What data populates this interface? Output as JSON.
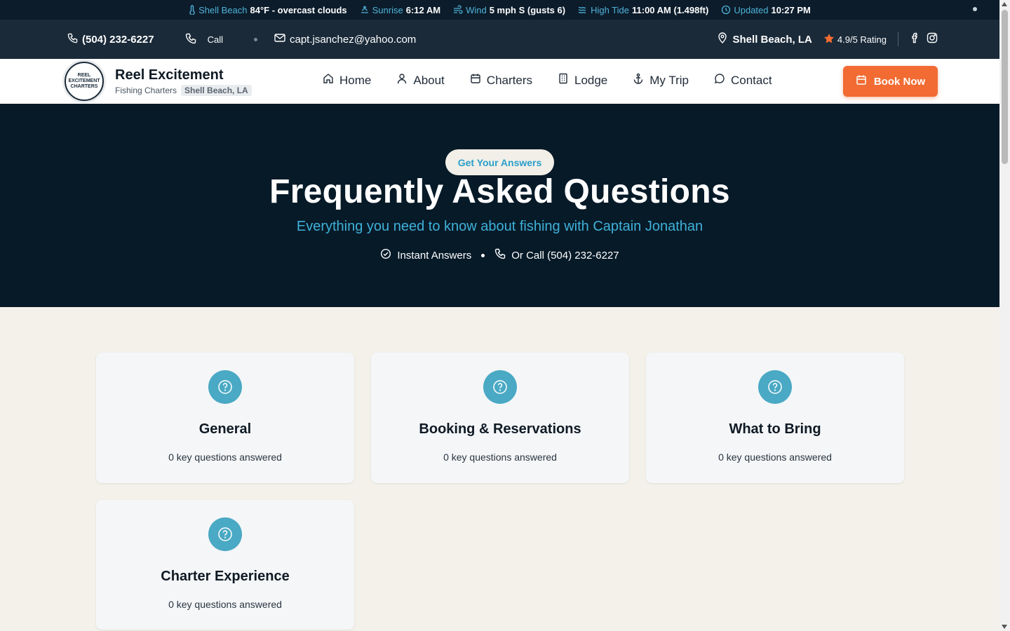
{
  "weather": {
    "location_label": "Shell Beach",
    "location_value": "84°F - overcast clouds",
    "sunrise_label": "Sunrise",
    "sunrise_value": "6:12 AM",
    "wind_label": "Wind",
    "wind_value": "5 mph S (gusts 6)",
    "tide_label": "High Tide",
    "tide_value": "11:00 AM (1.498ft)",
    "updated_label": "Updated",
    "updated_value": "10:27 PM"
  },
  "contact": {
    "phone": "(504) 232-6227",
    "call_label": "Call",
    "email": "capt.jsanchez@yahoo.com",
    "location": "Shell Beach, LA",
    "rating": "4.9/5 Rating"
  },
  "brand": {
    "name": "Reel Excitement",
    "subtitle": "Fishing Charters",
    "tag": "Shell Beach, LA",
    "logo_lines": [
      "REEL",
      "EXCITEMENT",
      "CHARTERS"
    ]
  },
  "nav": {
    "items": [
      {
        "label": "Home",
        "icon": "home-icon"
      },
      {
        "label": "About",
        "icon": "user-icon"
      },
      {
        "label": "Charters",
        "icon": "calendar-icon"
      },
      {
        "label": "Lodge",
        "icon": "building-icon"
      },
      {
        "label": "My Trip",
        "icon": "anchor-icon"
      },
      {
        "label": "Contact",
        "icon": "chat-icon"
      }
    ],
    "book_label": "Book Now"
  },
  "hero": {
    "pill": "Get Your Answers",
    "title": "Frequently Asked Questions",
    "subtitle": "Everything you need to know about fishing with Captain Jonathan",
    "meta_answers": "Instant Answers",
    "meta_call": "Or Call (504) 232-6227"
  },
  "categories": [
    {
      "title": "General",
      "count": "0 key questions answered"
    },
    {
      "title": "Booking & Reservations",
      "count": "0 key questions answered"
    },
    {
      "title": "What to Bring",
      "count": "0 key questions answered"
    },
    {
      "title": "Charter Experience",
      "count": "0 key questions answered"
    }
  ],
  "colors": {
    "accent": "#f26b32",
    "hero_bg": "#071a28",
    "highlight": "#3fb1d9",
    "icon_circle": "#4aa9c4"
  }
}
